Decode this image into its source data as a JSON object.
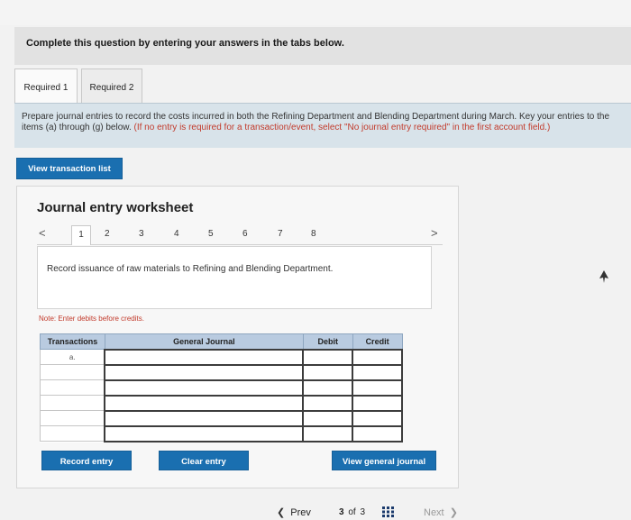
{
  "header": {
    "prompt": "Complete this question by entering your answers in the tabs below."
  },
  "tabs": [
    {
      "label": "Required 1"
    },
    {
      "label": "Required 2"
    }
  ],
  "instructions": {
    "text": "Prepare journal entries to record the costs incurred in both the Refining Department and Blending Department during March. Key your entries to the items (a) through (g) below. ",
    "note": "(If no entry is required for a transaction/event, select \"No journal entry required\" in the first account field.)"
  },
  "buttons": {
    "view_transaction_list": "View transaction list",
    "record_entry": "Record entry",
    "clear_entry": "Clear entry",
    "view_general_journal": "View general journal"
  },
  "worksheet": {
    "title": "Journal entry worksheet",
    "prev_arrow": "<",
    "next_arrow": ">",
    "pages": [
      "1",
      "2",
      "3",
      "4",
      "5",
      "6",
      "7",
      "8"
    ],
    "description": "Record issuance of raw materials to Refining and Blending Department.",
    "note": "Note: Enter debits before credits."
  },
  "journal": {
    "headers": {
      "transactions": "Transactions",
      "general_journal": "General Journal",
      "debit": "Debit",
      "credit": "Credit"
    },
    "rows": [
      {
        "transaction": "a."
      },
      {
        "transaction": ""
      },
      {
        "transaction": ""
      },
      {
        "transaction": ""
      },
      {
        "transaction": ""
      },
      {
        "transaction": ""
      }
    ]
  },
  "footer": {
    "prev": "Prev",
    "current_page": "3",
    "of": "of",
    "total_pages": "3",
    "next": "Next"
  },
  "icons": {
    "prev": "chevron-left-icon",
    "next": "chevron-right-icon",
    "grid": "grid-icon",
    "cursor": "cursor-icon"
  }
}
